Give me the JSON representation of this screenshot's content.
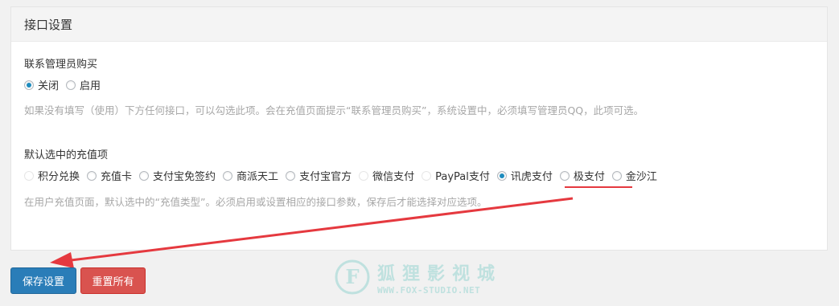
{
  "panel": {
    "title": "接口设置"
  },
  "contact_admin": {
    "label": "联系管理员购买",
    "options": [
      {
        "label": "关闭",
        "checked": true
      },
      {
        "label": "启用",
        "checked": false
      }
    ],
    "help": "如果没有填写（使用）下方任何接口，可以勾选此项。会在充值页面提示“联系管理员购买”，系统设置中，必须填写管理员QQ，此项可选。"
  },
  "default_recharge": {
    "label": "默认选中的充值项",
    "options": [
      {
        "label": "积分兑换",
        "checked": false
      },
      {
        "label": "充值卡",
        "checked": false
      },
      {
        "label": "支付宝免签约",
        "checked": false
      },
      {
        "label": "商派天工",
        "checked": false
      },
      {
        "label": "支付宝官方",
        "checked": false
      },
      {
        "label": "微信支付",
        "checked": false
      },
      {
        "label": "PayPal支付",
        "checked": false
      },
      {
        "label": "讯虎支付",
        "checked": true
      },
      {
        "label": "极支付",
        "checked": false
      },
      {
        "label": "金沙江",
        "checked": false
      }
    ],
    "help": "在用户充值页面，默认选中的“充值类型”。必须启用或设置相应的接口参数，保存后才能选择对应选项。"
  },
  "buttons": {
    "save": "保存设置",
    "reset": "重置所有"
  },
  "watermark": {
    "logo_letter": "F",
    "name": "狐狸影视城",
    "url": "WWW.FOX-STUDIO.NET"
  },
  "colors": {
    "accent": "#1e8cbe",
    "primary_button": "#2a7db8",
    "danger_button": "#d9534f",
    "annotation_red": "#e5393f"
  }
}
